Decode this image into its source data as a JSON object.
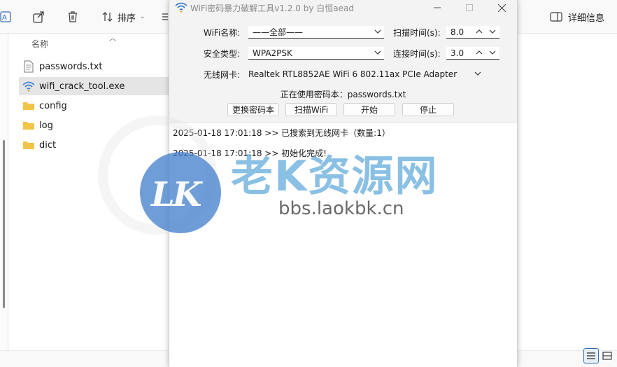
{
  "explorer": {
    "toolbar": {
      "sort_label": "排序",
      "details_label": "详细信息"
    },
    "column_name": "名称",
    "files": [
      {
        "name": "passwords.txt",
        "icon": "text-file-icon"
      },
      {
        "name": "wifi_crack_tool.exe",
        "icon": "wifi-exe-icon"
      },
      {
        "name": "config",
        "icon": "folder-icon"
      },
      {
        "name": "log",
        "icon": "folder-icon"
      },
      {
        "name": "dict",
        "icon": "folder-icon"
      }
    ]
  },
  "tool": {
    "title": "WiFi密码暴力破解工具v1.2.0 by 白恒aead",
    "wifi_name_label": "WiFi名称:",
    "wifi_name_value": "——全部——",
    "security_label": "安全类型:",
    "security_value": "WPA2PSK",
    "adapter_label": "无线网卡:",
    "adapter_value": "Realtek RTL8852AE WiFi 6 802.11ax PCIe Adapter",
    "scan_time_label": "扫描时间(s):",
    "scan_time_value": "8.0",
    "connect_time_label": "连接时间(s):",
    "connect_time_value": "3.0",
    "password_file_line": "正在使用密码本：passwords.txt",
    "buttons": {
      "change_dict": "更换密码本",
      "scan_wifi": "扫描WiFi",
      "start": "开始",
      "stop": "停止"
    },
    "log": [
      "2025-01-18 17:01:18 >> 已搜索到无线网卡（数量:1）",
      "2025-01-18 17:01:18 >> 初始化完成!"
    ]
  },
  "watermark": {
    "logo_text": "LK",
    "site_name": "老K资源网",
    "url": "bbs.laokbk.cn"
  },
  "colors": {
    "accent": "#3b6ea8",
    "folder": "#f3c44a",
    "watermark_blue": "#3c96d2"
  }
}
